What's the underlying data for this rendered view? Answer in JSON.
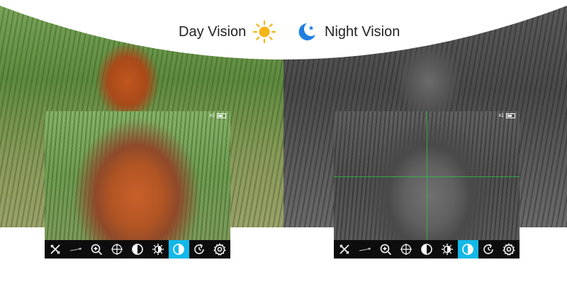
{
  "header": {
    "day_label": "Day Vision",
    "night_label": "Night Vision",
    "sun_icon": "sun-icon",
    "moon_icon": "moon-star-icon",
    "sun_color": "#f5b417",
    "moon_color": "#1f7fe0"
  },
  "day_screen": {
    "zoom": "x1"
  },
  "night_screen": {
    "zoom": "x1",
    "reticle_color": "#2ec24a"
  },
  "toolbar": {
    "active_color": "#13b8e8",
    "buttons": [
      {
        "name": "exit-icon"
      },
      {
        "name": "range-line-icon"
      },
      {
        "name": "zoom-in-icon"
      },
      {
        "name": "reticle-icon"
      },
      {
        "name": "contrast-icon"
      },
      {
        "name": "brightness-icon"
      },
      {
        "name": "day-night-mode-icon",
        "active": true
      },
      {
        "name": "rotate-icon"
      },
      {
        "name": "settings-gear-icon"
      }
    ]
  }
}
